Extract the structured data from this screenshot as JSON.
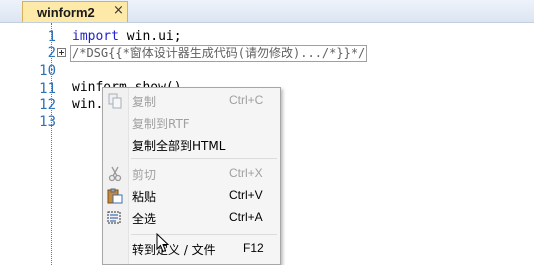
{
  "tab": {
    "title": "winform2",
    "close_glyph": "×"
  },
  "gutter": {
    "line_numbers": [
      "1",
      "2",
      "10",
      "11",
      "12",
      "13"
    ]
  },
  "code": {
    "line1_kw": "import",
    "line1_rest": " win.ui;",
    "line2_folded": "/*DSG{{*窗体设计器生成代码(请勿修改).../*}}*/",
    "line11": "winform.show()",
    "line12": "win."
  },
  "context_menu": {
    "items": [
      {
        "label": "复制",
        "shortcut": "Ctrl+C",
        "enabled": false,
        "icon": "copy-icon"
      },
      {
        "label": "复制到RTF",
        "shortcut": "",
        "enabled": false,
        "icon": ""
      },
      {
        "label": "复制全部到HTML",
        "shortcut": "",
        "enabled": true,
        "icon": ""
      },
      {
        "label": "剪切",
        "shortcut": "Ctrl+X",
        "enabled": false,
        "icon": "scissors-icon"
      },
      {
        "label": "粘贴",
        "shortcut": "Ctrl+V",
        "enabled": true,
        "icon": "paste-icon"
      },
      {
        "label": "全选",
        "shortcut": "Ctrl+A",
        "enabled": true,
        "icon": "select-all-icon"
      },
      {
        "label": "转到定义 / 文件",
        "shortcut": "F12",
        "enabled": true,
        "icon": ""
      }
    ]
  },
  "colors": {
    "tab_active": "#fde9a8",
    "keyword": "#1f1fd0",
    "line_number": "#2b72b8"
  }
}
